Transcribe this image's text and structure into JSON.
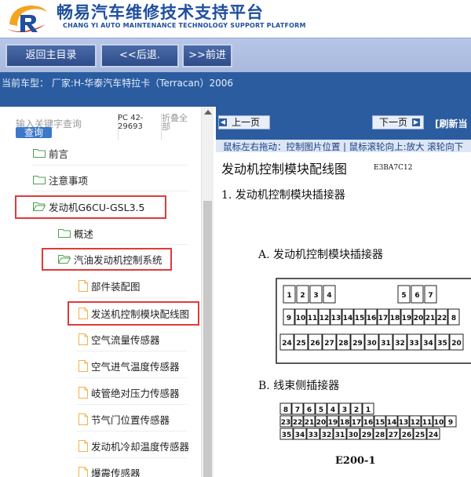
{
  "header": {
    "title": "畅易汽车维修技术支持平台",
    "subtitle": "CHANG YI AUTO MAINTENANCE TECHNOLOGY SUPPORT PLATFORM",
    "logo_icon": "ce-logo-icon"
  },
  "nav": {
    "home": "返回主目录",
    "back": "<<后退.",
    "forward": ">>前进"
  },
  "vehicle_info": "当前车型： 厂家:H-华泰汽车特拉卡（Terracan）2006",
  "sidebar": {
    "search_placeholder": "输入关键字查询",
    "search_button": "查询",
    "pc_code": "PC 42-29693",
    "fold_all": "折叠全部",
    "items": [
      {
        "label": "前言",
        "type": "folder"
      },
      {
        "label": "注意事项",
        "type": "folder"
      },
      {
        "label": "发动机G6CU-GSL3.5",
        "type": "folder"
      },
      {
        "label": "概述",
        "type": "folder"
      },
      {
        "label": "汽油发动机控制系统",
        "type": "folder"
      },
      {
        "label": "部件装配图",
        "type": "file"
      },
      {
        "label": "发送机控制模块配线图",
        "type": "file"
      },
      {
        "label": "空气流量传感器",
        "type": "file"
      },
      {
        "label": "空气进气温度传感器",
        "type": "file"
      },
      {
        "label": "岐管绝对压力传感器",
        "type": "file"
      },
      {
        "label": "节气门位置传感器",
        "type": "file"
      },
      {
        "label": "发动机冷却温度传感器",
        "type": "file"
      },
      {
        "label": "爆震传感器",
        "type": "file"
      }
    ]
  },
  "viewer": {
    "prev_page": "上一页",
    "next_page": "下一页",
    "refresh": "[刷新当",
    "hint": "鼠标左右拖动：控制图片位置 | 鼠标滚轮向上:放大  滚轮向下",
    "doc": {
      "title": "发动机控制模块配线图",
      "code": "E3BA7C12",
      "item1": "1.    发动机控制模块插接器",
      "section_a": "A.  发动机控制模块插接器",
      "section_b": "B.  线束侧插接器",
      "connector_id": "E200-1",
      "ecm_row1": [
        "1",
        "2",
        "3",
        "4",
        "5",
        "6",
        "7"
      ],
      "ecm_row2": [
        "9",
        "10",
        "11",
        "12",
        "13",
        "14",
        "15",
        "16",
        "17",
        "18",
        "19",
        "20",
        "21",
        "22",
        "8"
      ],
      "ecm_row3": [
        "24",
        "25",
        "26",
        "27",
        "28",
        "29",
        "30",
        "31",
        "32",
        "33",
        "34",
        "35",
        "20"
      ],
      "harness_row1": [
        "8",
        "7",
        "6",
        "5",
        "4",
        "3",
        "2",
        "1"
      ],
      "harness_row2": [
        "23",
        "22",
        "21",
        "20",
        "19",
        "18",
        "17",
        "16",
        "15",
        "14",
        "13",
        "12",
        "11",
        "10",
        "9"
      ],
      "harness_row3": [
        "35",
        "34",
        "33",
        "32",
        "31",
        "30",
        "29",
        "28",
        "27",
        "26",
        "25",
        "24"
      ]
    }
  }
}
